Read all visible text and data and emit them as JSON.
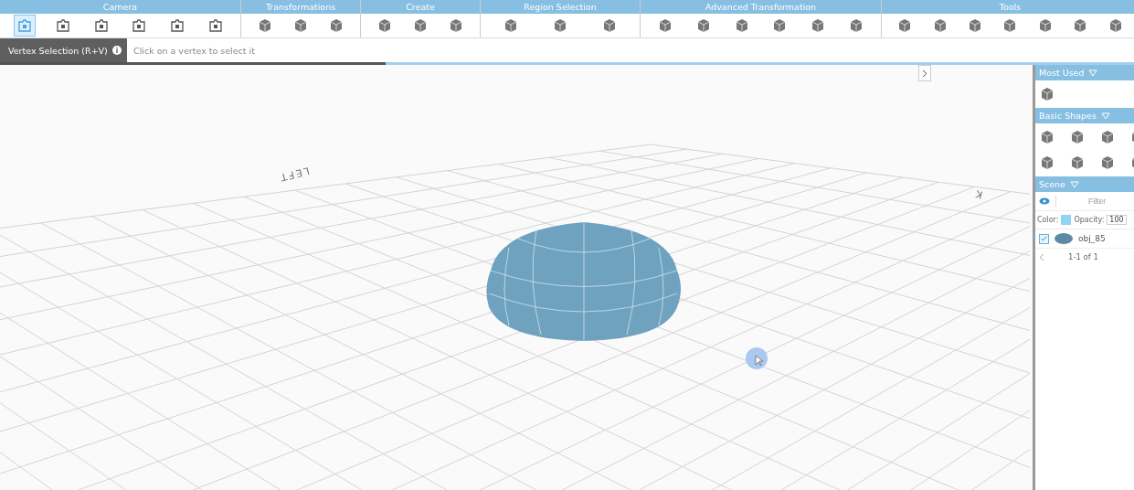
{
  "toolbar": {
    "groups": [
      {
        "label": "Camera",
        "tools": [
          {
            "kind": "camera",
            "selected": true
          },
          {
            "kind": "camera",
            "selected": false
          },
          {
            "kind": "camera",
            "selected": false
          },
          {
            "kind": "camera",
            "selected": false
          },
          {
            "kind": "camera",
            "selected": false
          },
          {
            "kind": "camera",
            "selected": false
          }
        ]
      },
      {
        "label": "Transformations",
        "tools": [
          {
            "kind": "cube",
            "selected": false
          },
          {
            "kind": "cube",
            "selected": false
          },
          {
            "kind": "cube",
            "selected": false
          }
        ]
      },
      {
        "label": "Create",
        "tools": [
          {
            "kind": "cube",
            "selected": false
          },
          {
            "kind": "cube",
            "selected": false
          },
          {
            "kind": "cube",
            "selected": false
          }
        ]
      },
      {
        "label": "Region Selection",
        "tools": [
          {
            "kind": "cube",
            "selected": false
          },
          {
            "kind": "cube",
            "selected": false
          },
          {
            "kind": "cube",
            "selected": false
          }
        ]
      },
      {
        "label": "Advanced Transformation",
        "tools": [
          {
            "kind": "cube",
            "selected": false
          },
          {
            "kind": "cube",
            "selected": false
          },
          {
            "kind": "cube",
            "selected": false
          },
          {
            "kind": "cube",
            "selected": false
          },
          {
            "kind": "cube",
            "selected": false
          },
          {
            "kind": "cube",
            "selected": false
          }
        ]
      },
      {
        "label": "Tools",
        "tools": [
          {
            "kind": "cube",
            "selected": false
          },
          {
            "kind": "cube",
            "selected": false
          },
          {
            "kind": "cube",
            "selected": false
          },
          {
            "kind": "cube",
            "selected": false
          },
          {
            "kind": "cube",
            "selected": false
          },
          {
            "kind": "cube",
            "selected": false
          },
          {
            "kind": "cube",
            "selected": false
          }
        ]
      }
    ]
  },
  "mode": {
    "label": "Vertex Selection (R+V)",
    "hint": "Click on a vertex to select it"
  },
  "progress": {
    "level": 0.34
  },
  "viewport": {
    "labels": [
      "LEFT",
      "K"
    ]
  },
  "panel": {
    "most_used": {
      "title": "Most Used",
      "shapes": [
        {
          "kind": "cube"
        }
      ]
    },
    "basic_shapes": {
      "title": "Basic Shapes",
      "shapes": [
        {
          "kind": "cube"
        },
        {
          "kind": "cube"
        },
        {
          "kind": "cube"
        },
        {
          "kind": "cube"
        },
        {
          "kind": "cube"
        },
        {
          "kind": "cube"
        },
        {
          "kind": "cube"
        },
        {
          "kind": "cube"
        }
      ]
    },
    "scene": {
      "title": "Scene",
      "filter_placeholder": "Filter",
      "color_label": "Color:",
      "color": "#8fd3f5",
      "opacity_label": "Opacity:",
      "opacity": "100",
      "objects": [
        {
          "name": "obj_85",
          "checked": true
        }
      ],
      "pager": "1-1 of 1"
    }
  }
}
